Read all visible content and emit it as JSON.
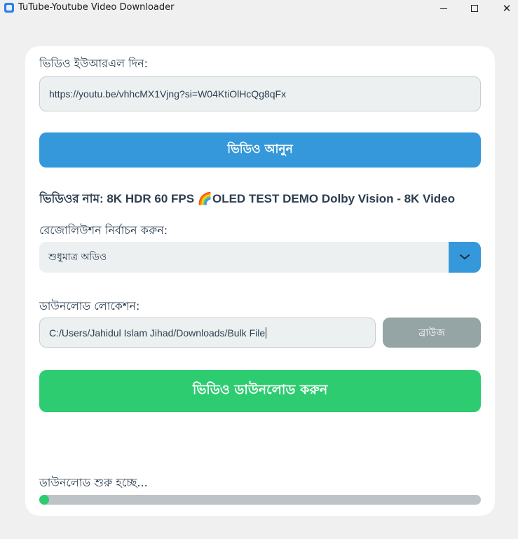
{
  "window": {
    "title": "TuTube-Youtube Video Downloader",
    "controls": {
      "minimize": "minimize",
      "maximize": "maximize",
      "close": "✕"
    }
  },
  "url_section": {
    "label": "ভিডিও ইউআরএল দিন:",
    "value": "https://youtu.be/vhhcMX1Vjng?si=W04KtiOlHcQg8qFx",
    "fetch_button": "ভিডিও আনুন"
  },
  "video_name": "ভিডিওর নাম: 8K HDR 60 FPS 🌈OLED TEST DEMO Dolby Vision - 8K Video",
  "resolution": {
    "label": "রেজোলিউশন নির্বাচন করুন:",
    "selected": "শুধুমাত্র অডিও"
  },
  "location": {
    "label": "ডাউনলোড লোকেশন:",
    "value": "C:/Users/Jahidul Islam Jihad/Downloads/Bulk File",
    "browse_button": "ব্রাউজ"
  },
  "download_button": "ভিডিও ডাউনলোড করুন",
  "status": {
    "text": "ডাউনলোড শুরু হচ্ছে...",
    "progress": 0.02
  },
  "colors": {
    "primary": "#3498db",
    "success": "#2ecc71",
    "muted": "#95a5a6",
    "text": "#2c3e50"
  }
}
